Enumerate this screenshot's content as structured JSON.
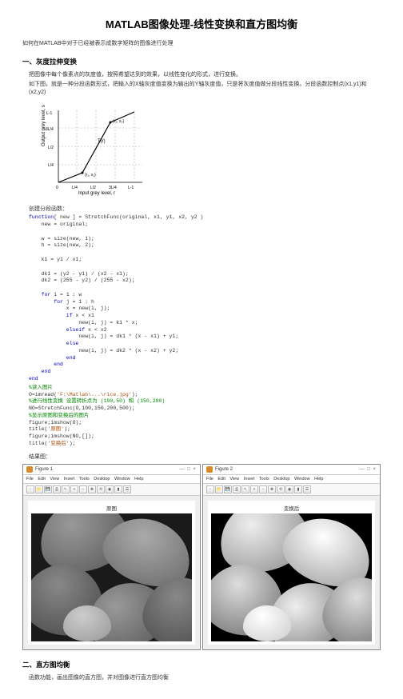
{
  "title": "MATLAB图像处理-线性变换和直方图均衡",
  "intro": "如何在MATLAB中对于已经被表示成数字矩阵的图像进行处理",
  "sec1": {
    "heading": "一、灰度拉伸变换",
    "p1": "把图像中每个像素点的灰度值，按照希望达到的效果，以线性变化的形式，进行变换。",
    "p2": "如下图，就是一种分段函数形式，把输入的X轴灰度值变换为输出的Y轴灰度值，只是将灰度值做分段线性变换。分段函数控制点(x1,y1)和(x2,y2)",
    "graph": {
      "ylabel": "Output grey level, s",
      "xlabel": "Input grey level, r",
      "yticks": [
        "L-1",
        "3L/4",
        "L/2",
        "L/4"
      ],
      "xticks": [
        "0",
        "L/4",
        "L/2",
        "3L/4",
        "L-1"
      ],
      "fn": "T(r)",
      "pt1": "(r₁, s₁)",
      "pt2": "(r₂, s₂)"
    },
    "sub1": "创建分段函数：",
    "code1_l1": "function",
    "code1_l1b": "[ new ] = StretchFunc(original, x1, y1, x2, y2 )",
    "code1_l2": "    new = original;",
    "code1_l3": "    w = size(new, 1);",
    "code1_l4": "    h = size(new, 2);",
    "code1_l5": "    k1 = y1 / x1;",
    "code1_l6": "    dk1 = (y2 - y1) / (x2 - x1);",
    "code1_l7": "    dk2 = (255 - y2) / (255 - x2);",
    "code1_l8a": "    for",
    "code1_l8b": " i = 1 : w",
    "code1_l9a": "        for",
    "code1_l9b": " j = 1 : h",
    "code1_l10": "            x = new(i, j);",
    "code1_l11a": "            if",
    "code1_l11b": " x < x1",
    "code1_l12": "                new(i, j) = k1 * x;",
    "code1_l13a": "            elseif",
    "code1_l13b": " x < x2",
    "code1_l14": "                new(i, j) = dk1 * (x - x1) + y1;",
    "code1_l15a": "            else",
    "code1_l16": "                new(i, j) = dk2 * (x - x2) + y2;",
    "code1_l17a": "            end",
    "code1_l18a": "        end",
    "code1_l19a": "    end",
    "code1_l20a": "end",
    "sub2": "%读入图片",
    "code2_l1": "O=imread(",
    "code2_l1s": "'F:\\Matlab\\...\\rice.jpg'",
    "code2_l1e": ");",
    "code2_c2": "%进行线性变换 设置转折点为 (100,50) 和 (150,200)",
    "code2_l2": "NO=StretchFunc(O,100,150,200,500);",
    "code2_c3": "%显示原图和变换后的图片",
    "code2_l3": "figure;imshow(O);",
    "code2_l4": "title(",
    "code2_l4s": "'原图'",
    "code2_l4e": ");",
    "code2_l5": "figure;imshow(NO,[]);",
    "code2_l6": "title(",
    "code2_l6s": "'变换后'",
    "code2_l6e": ");",
    "sub3": "结果图：",
    "fig1": {
      "wintitle": "Figure 1",
      "menu": "File Edit View Insert Tools Desktop Window Help",
      "caption": "原图"
    },
    "fig2": {
      "wintitle": "Figure 2",
      "menu": "File Edit View Insert Tools Desktop Window Help",
      "caption": "变换后"
    }
  },
  "sec2": {
    "heading": "二、直方图均衡",
    "p1": "函数功能，画出图像的直方图，并对图像进行直方图均衡"
  }
}
